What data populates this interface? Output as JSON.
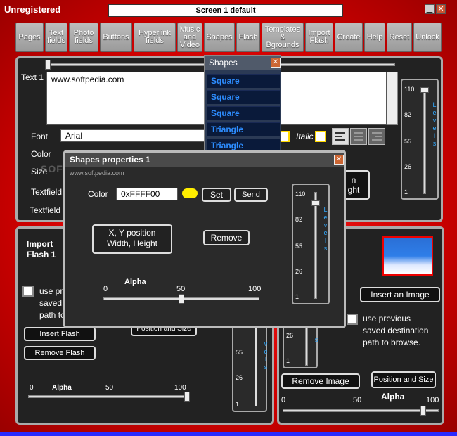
{
  "app": {
    "title": "Unregistered",
    "screen_name": "Screen 1 default"
  },
  "window_controls": {
    "minimize": "▁",
    "close": "✕"
  },
  "toolbar": [
    "Pages",
    "Text\nfields",
    "Photo\nfields",
    "Buttons",
    "Hyperlink\nfields",
    "Music\nand\nVideo",
    "Shapes",
    "Flash",
    "Templates\n&\nBgrounds",
    "Import\nFlash",
    "Create",
    "Help",
    "Reset",
    "Unlock"
  ],
  "text_panel": {
    "text_label": "Text 1",
    "text_value": "www.softpedia.com",
    "font_label": "Font",
    "font_value": "Arial",
    "color_label": "Color",
    "size_label": "Size",
    "textfield1_label": "Textfield",
    "textfield2_label": "Textfield",
    "italic_label": "Italic",
    "partial_button_line1": "n",
    "partial_button_line2": "ght",
    "watermark": "SOFTPEDIA"
  },
  "levels": {
    "ticks": [
      "110",
      "82",
      "55",
      "26",
      "1"
    ],
    "partial_ticks": [
      "55",
      "26",
      "1"
    ],
    "right_partial_ticks": [
      "26",
      "1"
    ],
    "vertical_text": "L e v e l s",
    "partial_vertical_text": "v e l s",
    "right_partial_vertical_text": "s"
  },
  "shapes_window": {
    "title": "Shapes",
    "items": [
      "Square",
      "Square",
      "Square",
      "Triangle",
      "Triangle"
    ]
  },
  "props_window": {
    "title": "Shapes properties 1",
    "subtitle": "www.softpedia.com",
    "color_label": "Color",
    "color_value": "0xFFFF00",
    "swatch_color": "#ffee00",
    "set_button": "Set",
    "send_button": "Send",
    "xy_button": "X, Y position\nWidth, Height",
    "remove_button": "Remove",
    "alpha_label": "Alpha",
    "alpha_ticks": [
      "0",
      "50",
      "100"
    ],
    "alpha_value": 0.5
  },
  "left_panel": {
    "title_line1": "Import",
    "title_line2": "Flash 1",
    "use_prev_lines": [
      "use pre",
      "saved",
      "path to"
    ],
    "insert_flash": "Insert Flash",
    "remove_flash": "Remove Flash",
    "position_size_partial": "Position and Size",
    "alpha_label": "Alpha",
    "alpha_ticks": [
      "0",
      "50",
      "100"
    ],
    "alpha_value": 1.0
  },
  "right_panel": {
    "insert_image": "Insert an Image",
    "use_prev_lines": [
      "use previous",
      "saved destination",
      "path to browse."
    ],
    "remove_image": "Remove Image",
    "position_size": "Position and Size",
    "alpha_label": "Alpha",
    "alpha_ticks": [
      "0",
      "50",
      "100"
    ],
    "alpha_value": 0.9
  }
}
